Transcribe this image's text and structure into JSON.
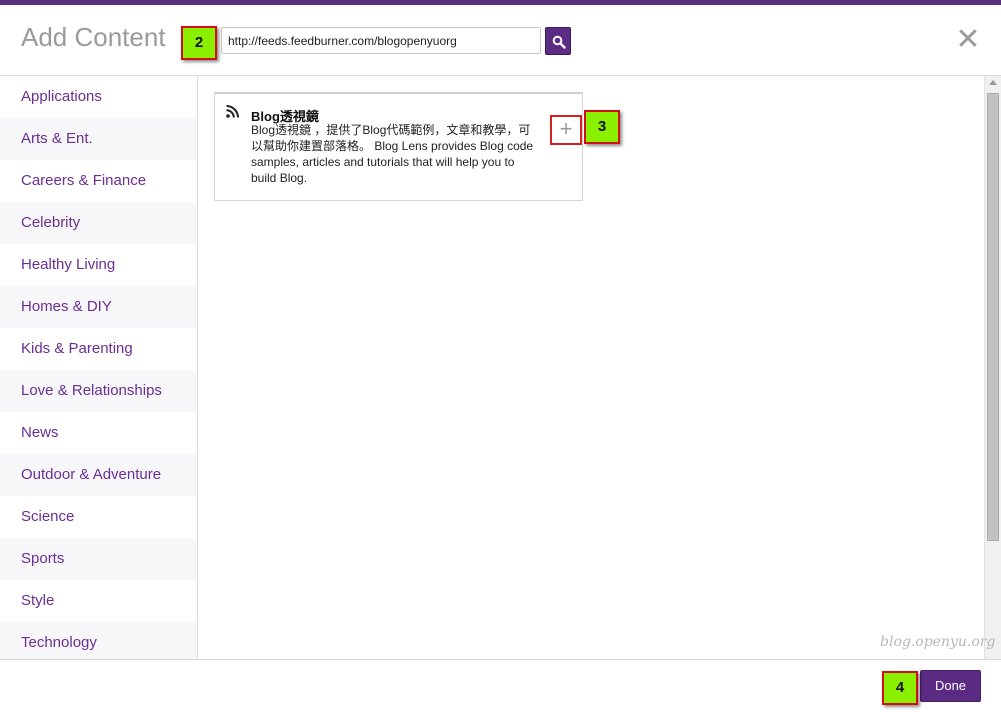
{
  "header": {
    "title": "Add Content",
    "url_value": "http://feeds.feedburner.com/blogopenyuorg",
    "close_symbol": "✕"
  },
  "callouts": {
    "search": "2",
    "add": "3",
    "done": "4"
  },
  "sidebar": {
    "items": [
      {
        "label": "Applications"
      },
      {
        "label": "Arts & Ent."
      },
      {
        "label": "Careers & Finance"
      },
      {
        "label": "Celebrity"
      },
      {
        "label": "Healthy Living"
      },
      {
        "label": "Homes & DIY"
      },
      {
        "label": "Kids & Parenting"
      },
      {
        "label": "Love & Relationships"
      },
      {
        "label": "News"
      },
      {
        "label": "Outdoor & Adventure"
      },
      {
        "label": "Science"
      },
      {
        "label": "Sports"
      },
      {
        "label": "Style"
      },
      {
        "label": "Technology"
      }
    ]
  },
  "result": {
    "title": "Blog透視鏡",
    "description": "Blog透視鏡 ，提供了Blog代碼範例，文章和教學，可以幫助你建置部落格。 Blog Lens provides Blog code samples, articles and tutorials that will help you to build Blog.",
    "add_symbol": "+",
    "icon": "rss-icon"
  },
  "watermark": "blog.openyu.org",
  "footer": {
    "done_label": "Done"
  },
  "colors": {
    "accent": "#5b2b83",
    "link": "#6a2f92",
    "callout_fill": "#8af000",
    "callout_border": "#d01010"
  }
}
